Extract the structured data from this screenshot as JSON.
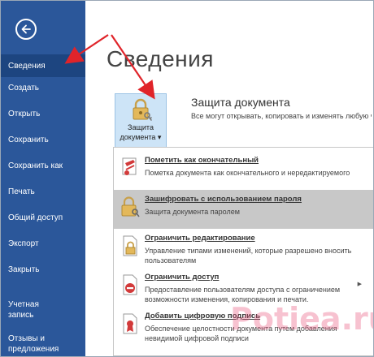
{
  "sidebar": {
    "items": [
      {
        "label": "Сведения"
      },
      {
        "label": "Создать"
      },
      {
        "label": "Открыть"
      },
      {
        "label": "Сохранить"
      },
      {
        "label": "Сохранить как"
      },
      {
        "label": "Печать"
      },
      {
        "label": "Общий доступ"
      },
      {
        "label": "Экспорт"
      },
      {
        "label": "Закрыть"
      },
      {
        "label": "Учетная запись"
      },
      {
        "label": "Отзывы и предложения"
      }
    ],
    "colors": {
      "background": "#2b579a",
      "active": "#1d4580"
    }
  },
  "main": {
    "title": "Сведения",
    "protect_button": {
      "line1": "Защита",
      "line2": "документа ▾",
      "icon": "lock-key-icon"
    },
    "section_title": "Защита документа",
    "section_desc": "Все могут открывать, копировать и изменять любую часть этого документа."
  },
  "dropdown": {
    "items": [
      {
        "title": "Пометить как окончательный",
        "desc": "Пометка документа как окончательного и нередактируемого",
        "icon": "ribbon-document-icon"
      },
      {
        "title": "Зашифровать с использованием пароля",
        "desc": "Защита документа паролем",
        "icon": "lock-key-icon"
      },
      {
        "title": "Ограничить редактирование",
        "desc": "Управление типами изменений, которые разрешено вносить пользователям",
        "icon": "lock-document-icon"
      },
      {
        "title": "Ограничить доступ",
        "desc": "Предоставление пользователям доступа с ограничением возможности изменения, копирования и печати.",
        "icon": "restrict-access-icon",
        "has_submenu": true
      },
      {
        "title": "Добавить цифровую подпись",
        "desc": "Обеспечение целостности документа путем добавления невидимой цифровой подписи",
        "icon": "signature-ribbon-icon"
      }
    ],
    "highlight_color": "#c8c8c8"
  },
  "watermark": "Potiea.ru"
}
